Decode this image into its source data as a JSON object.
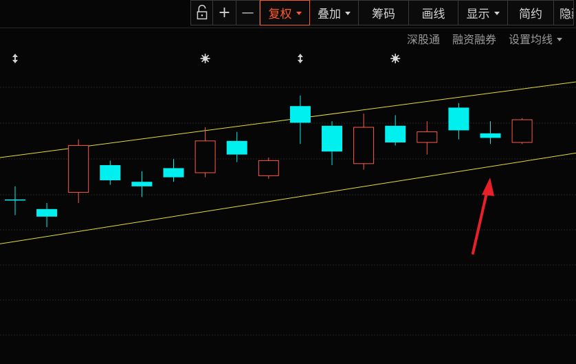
{
  "toolbar": {
    "zoom_in": "+",
    "zoom_out": "—",
    "fuquan": "复权",
    "diejia": "叠加",
    "chouma": "筹码",
    "huaxian": "画线",
    "xianshi": "显示",
    "jianyue": "简约",
    "yincang": "隐藏"
  },
  "subbar": {
    "shengutong": "深股通",
    "rongzi": "融资融券",
    "junxian": "设置均线"
  },
  "colors": {
    "up": "#ff5a4a",
    "down": "#00f0f0",
    "channel": "#e7e02b",
    "grid": "#242424",
    "arrow": "#e8202a"
  },
  "chart_data": {
    "type": "candlestick",
    "ylim": [
      0,
      100
    ],
    "candles": [
      {
        "o": 38.5,
        "c": 38.5,
        "h": 43.0,
        "l": 33.5,
        "dir": "flat"
      },
      {
        "o": 35.5,
        "c": 33.0,
        "h": 37.5,
        "l": 29.5,
        "dir": "down"
      },
      {
        "o": 41.0,
        "c": 56.5,
        "h": 58.5,
        "l": 37.5,
        "dir": "up"
      },
      {
        "o": 50.0,
        "c": 45.0,
        "h": 51.5,
        "l": 43.5,
        "dir": "down"
      },
      {
        "o": 44.5,
        "c": 43.0,
        "h": 48.0,
        "l": 39.5,
        "dir": "down"
      },
      {
        "o": 49.0,
        "c": 46.0,
        "h": 52.0,
        "l": 44.5,
        "dir": "down"
      },
      {
        "o": 47.5,
        "c": 58.0,
        "h": 62.5,
        "l": 46.0,
        "dir": "up"
      },
      {
        "o": 58.0,
        "c": 53.5,
        "h": 61.0,
        "l": 51.0,
        "dir": "down"
      },
      {
        "o": 46.5,
        "c": 51.5,
        "h": 52.5,
        "l": 45.5,
        "dir": "up"
      },
      {
        "o": 69.5,
        "c": 64.0,
        "h": 73.0,
        "l": 57.0,
        "dir": "down"
      },
      {
        "o": 63.0,
        "c": 54.5,
        "h": 64.5,
        "l": 50.0,
        "dir": "down"
      },
      {
        "o": 50.5,
        "c": 62.5,
        "h": 67.0,
        "l": 48.5,
        "dir": "up"
      },
      {
        "o": 63.0,
        "c": 57.5,
        "h": 66.5,
        "l": 56.5,
        "dir": "down"
      },
      {
        "o": 57.5,
        "c": 61.0,
        "h": 64.5,
        "l": 53.5,
        "dir": "up"
      },
      {
        "o": 69.0,
        "c": 61.5,
        "h": 70.5,
        "l": 58.5,
        "dir": "down"
      },
      {
        "o": 60.5,
        "c": 59.0,
        "h": 64.5,
        "l": 57.0,
        "dir": "down"
      },
      {
        "o": 57.5,
        "c": 65.0,
        "h": 65.5,
        "l": 57.0,
        "dir": "up"
      }
    ],
    "channel": {
      "upper": {
        "from": 52.5,
        "to": 77.5
      },
      "lower": {
        "from": 24.0,
        "to": 54.0
      }
    },
    "event_markers": [
      {
        "index": 0,
        "kind": "split"
      },
      {
        "index": 6,
        "kind": "info"
      },
      {
        "index": 9,
        "kind": "split"
      },
      {
        "index": 12,
        "kind": "info"
      }
    ]
  }
}
